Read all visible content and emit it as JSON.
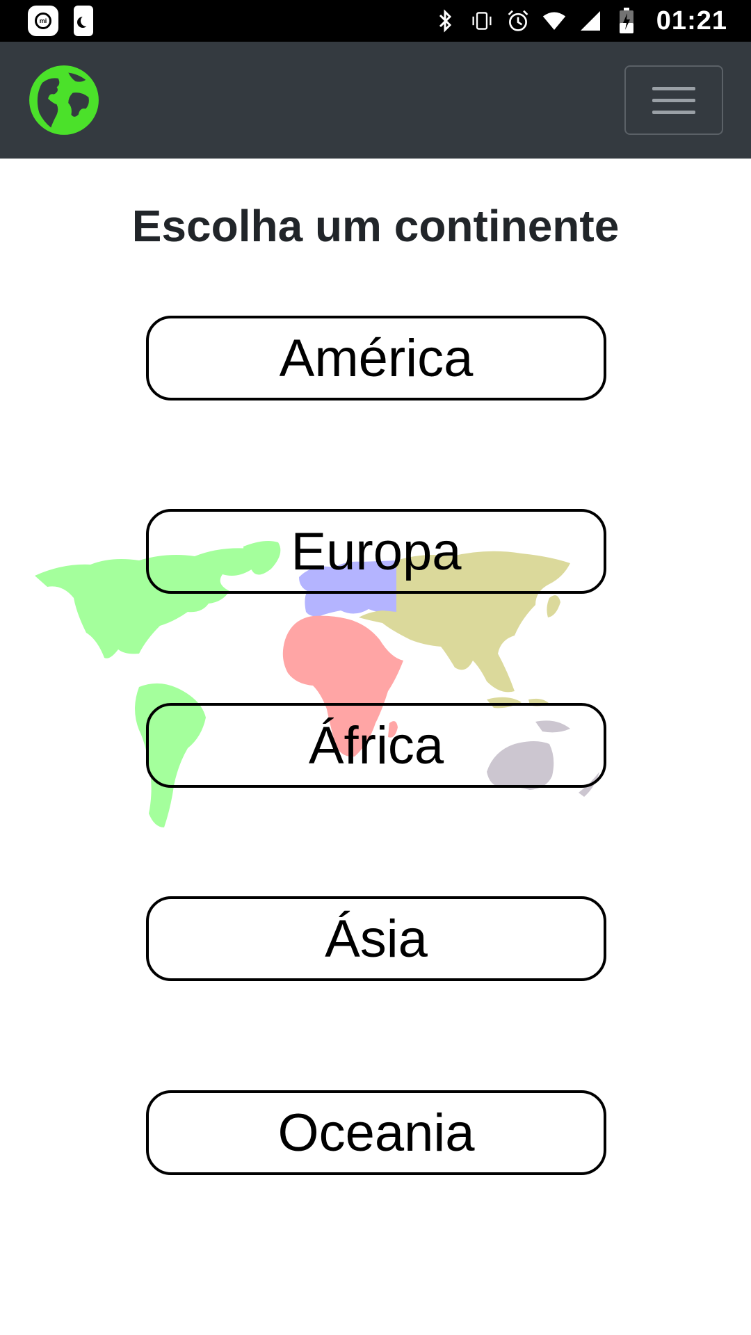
{
  "status_bar": {
    "time": "01:21",
    "icons": [
      "mi-app-icon",
      "night-mode-icon",
      "bluetooth-icon",
      "vibrate-icon",
      "alarm-icon",
      "wifi-icon",
      "signal-icon",
      "battery-charging-icon"
    ]
  },
  "navbar": {
    "logo_icon": "globe-icon",
    "logo_color": "#4be12a",
    "background": "#343a40",
    "menu_icon": "hamburger-menu-icon"
  },
  "main": {
    "title": "Escolha um continente",
    "continents": [
      {
        "label": "América",
        "color": "#4cff3c"
      },
      {
        "label": "Europa",
        "color": "#6b6bff"
      },
      {
        "label": "África",
        "color": "#ff4d4d"
      },
      {
        "label": "Ásia",
        "color": "#b8b43a"
      },
      {
        "label": "Oceania",
        "color": "#9a8ea2"
      }
    ]
  }
}
